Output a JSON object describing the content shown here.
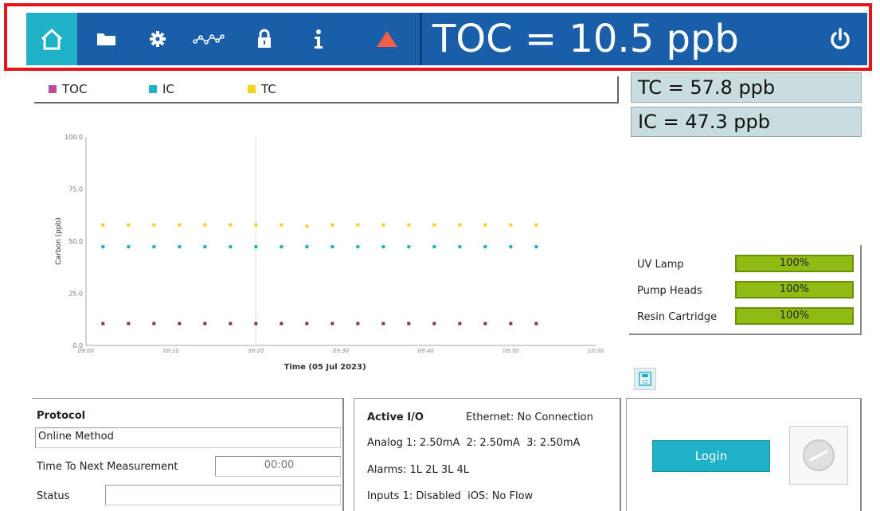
{
  "topbar": {
    "toc_reading": "TOC = 10.5 ppb",
    "icons": [
      "home-icon",
      "folder-icon",
      "gear-icon",
      "trend-icon",
      "lock-icon",
      "info-icon",
      "warning-icon",
      "power-icon"
    ]
  },
  "legend": {
    "items": [
      {
        "label": "TOC",
        "color": "#b84f9a"
      },
      {
        "label": "IC",
        "color": "#1fb1c8"
      },
      {
        "label": "TC",
        "color": "#f5d21f"
      }
    ]
  },
  "readings": {
    "tc": "TC = 57.8 ppb",
    "ic": "IC = 47.3 ppb"
  },
  "consumables": [
    {
      "label": "UV Lamp",
      "value_text": "100%",
      "value": 100
    },
    {
      "label": "Pump Heads",
      "value_text": "100%",
      "value": 100
    },
    {
      "label": "Resin Cartridge",
      "value_text": "100%",
      "value": 100
    }
  ],
  "protocol": {
    "title": "Protocol",
    "method": "Online Method",
    "next_label": "Time To Next Measurement",
    "next_value": "00:00",
    "status_label": "Status",
    "status_value": ""
  },
  "io": {
    "title": "Active I/O",
    "ethernet": "Ethernet: No Connection",
    "analog": "Analog 1: 2.50mA  2: 2.50mA  3: 2.50mA",
    "alarms": "Alarms: 1L 2L 3L 4L",
    "inputs": "Inputs 1: Disabled  iOS: No Flow"
  },
  "login": {
    "button_label": "Login"
  },
  "chart_data": {
    "type": "scatter",
    "xlabel": "Time (05 Jul 2023)",
    "ylabel": "Carbon (ppb)",
    "ylim": [
      0,
      100
    ],
    "yticks": [
      "0.0",
      "25.0",
      "50.0",
      "75.0",
      "100.0"
    ],
    "xticks": [
      "09:00",
      "09:10",
      "09:20",
      "09:30",
      "09:40",
      "09:50",
      "10:00"
    ],
    "xlim_minutes": [
      0,
      60
    ],
    "x_minutes": [
      2,
      5,
      8,
      11,
      14,
      17,
      20,
      23,
      26,
      29,
      32,
      35,
      38,
      41,
      44,
      47,
      50,
      53
    ],
    "series": [
      {
        "name": "TC",
        "color": "#f5d21f",
        "values": [
          57.8,
          57.8,
          57.8,
          57.8,
          57.8,
          57.8,
          57.8,
          57.8,
          57.2,
          57.8,
          57.8,
          57.8,
          57.8,
          57.8,
          57.8,
          57.8,
          57.8,
          57.8
        ]
      },
      {
        "name": "IC",
        "color": "#1fb1c8",
        "values": [
          47.3,
          47.3,
          47.3,
          47.3,
          47.3,
          47.3,
          47.3,
          47.3,
          47.3,
          47.3,
          47.3,
          47.3,
          47.3,
          47.3,
          47.3,
          47.3,
          47.3,
          47.3
        ]
      },
      {
        "name": "TOC",
        "color": "#7a3b5e",
        "values": [
          10.5,
          10.5,
          10.5,
          10.5,
          10.5,
          10.5,
          10.5,
          10.5,
          10.5,
          10.5,
          10.5,
          10.5,
          10.5,
          10.5,
          10.5,
          10.5,
          10.5,
          10.5
        ]
      }
    ],
    "grid": false
  }
}
